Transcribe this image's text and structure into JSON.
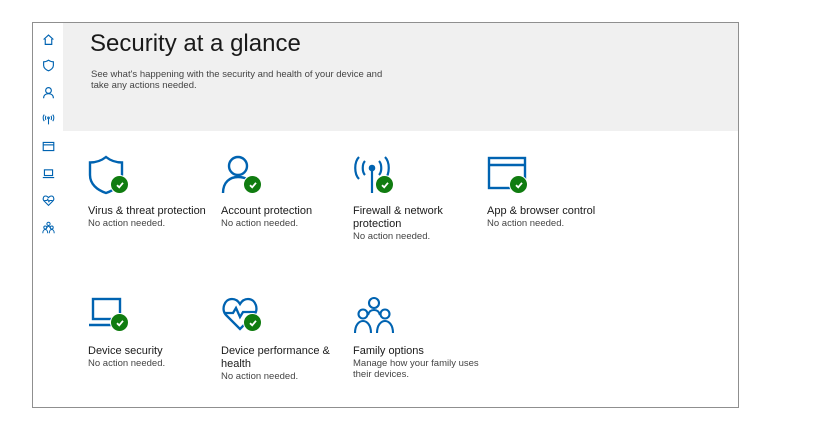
{
  "header": {
    "title": "Security at a glance",
    "subtitle": "See what's happening with the security and health of your device and take any actions needed."
  },
  "sidebar": {
    "items": [
      {
        "icon": "home-icon"
      },
      {
        "icon": "shield-icon"
      },
      {
        "icon": "person-icon"
      },
      {
        "icon": "wifi-icon"
      },
      {
        "icon": "browser-icon"
      },
      {
        "icon": "laptop-icon"
      },
      {
        "icon": "heart-icon"
      },
      {
        "icon": "family-icon"
      }
    ]
  },
  "tiles": [
    {
      "title": "Virus & threat protection",
      "status": "No action needed.",
      "icon": "shield-icon"
    },
    {
      "title": "Account protection",
      "status": "No action needed.",
      "icon": "person-icon"
    },
    {
      "title": "Firewall & network protection",
      "status": "No action needed.",
      "icon": "wifi-icon"
    },
    {
      "title": "App & browser control",
      "status": "No action needed.",
      "icon": "browser-icon"
    },
    {
      "title": "Device security",
      "status": "No action needed.",
      "icon": "laptop-icon"
    },
    {
      "title": "Device performance & health",
      "status": "No action needed.",
      "icon": "heart-icon"
    },
    {
      "title": "Family options",
      "status": "Manage how your family uses their devices.",
      "icon": "family-icon"
    }
  ],
  "colors": {
    "accent": "#0063b1",
    "ok_badge": "#107c10",
    "header_bg": "#f0f0f0"
  }
}
